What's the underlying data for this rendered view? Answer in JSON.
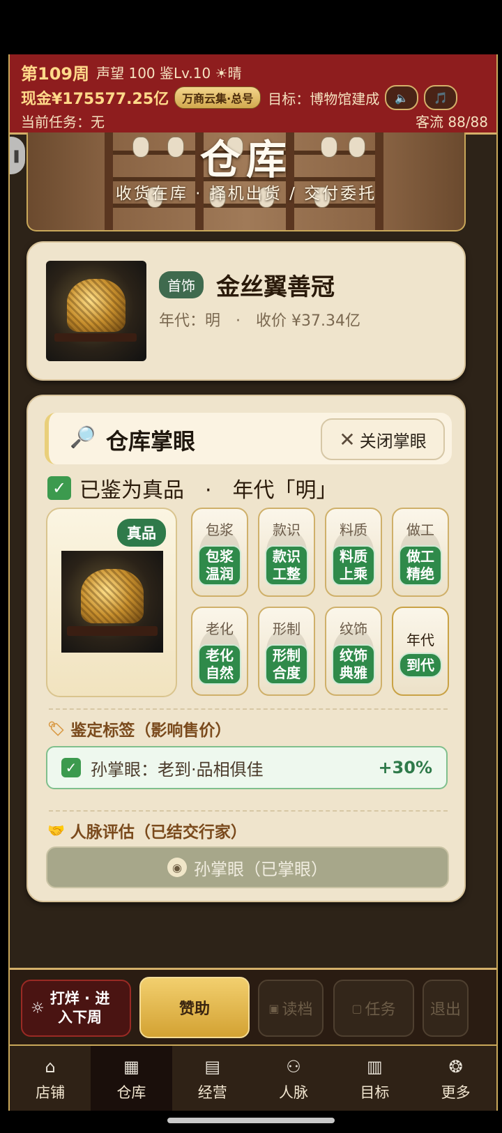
{
  "hud": {
    "week": "第109周",
    "stats": "声望 100 鉴Lv.10 ☀晴",
    "cash": "现金¥175577.25亿",
    "store_badge": "万商云集·总号",
    "goal": "目标：博物馆建成",
    "sound_icon": "🔈",
    "music_icon": "🎵",
    "task": "当前任务：无",
    "traffic": "客流 88/88"
  },
  "banner": {
    "title": "仓库",
    "subtitle": "收货在库 · 择机出货 / 交付委托"
  },
  "item": {
    "category": "首饰",
    "name": "金丝翼善冠",
    "info": "年代：明　·　收价 ¥37.34亿"
  },
  "appraisal": {
    "title": "仓库掌眼",
    "close_label": "关闭掌眼",
    "verdict": "已鉴为真品　·　年代「明」",
    "badge": "真品",
    "tiles": [
      {
        "label": "包浆",
        "result_1": "包浆",
        "result_2": "温润"
      },
      {
        "label": "款识",
        "result_1": "款识",
        "result_2": "工整"
      },
      {
        "label": "料质",
        "result_1": "料质",
        "result_2": "上乘"
      },
      {
        "label": "做工",
        "result_1": "做工",
        "result_2": "精绝"
      },
      {
        "label": "老化",
        "result_1": "老化",
        "result_2": "自然"
      },
      {
        "label": "形制",
        "result_1": "形制",
        "result_2": "合度"
      },
      {
        "label": "纹饰",
        "result_1": "纹饰",
        "result_2": "典雅"
      },
      {
        "label": "年代",
        "result": "到代"
      }
    ],
    "labels_heading": "鉴定标签（影响售价）",
    "label_text": "孙掌眼：老到·品相俱佳",
    "label_pct": "+30%",
    "contacts_heading": "人脉评估（已结交行家）",
    "contact_button": "孙掌眼（已掌眼）"
  },
  "actions": {
    "next_week_1": "打烊 · 进",
    "next_week_2": "入下周",
    "sponsor": "赞助",
    "load": "读档",
    "task": "任务",
    "exit": "退出"
  },
  "tabs": [
    {
      "label": "店铺",
      "icon": "shop-icon"
    },
    {
      "label": "仓库",
      "icon": "warehouse-icon"
    },
    {
      "label": "经营",
      "icon": "abacus-icon"
    },
    {
      "label": "人脉",
      "icon": "people-icon"
    },
    {
      "label": "目标",
      "icon": "scroll-icon"
    },
    {
      "label": "更多",
      "icon": "more-icon"
    }
  ],
  "colors": {
    "hud_red": "#8e1d1e",
    "gold": "#d4b06a",
    "green": "#2f8a4a",
    "paper": "#efe4cc"
  }
}
